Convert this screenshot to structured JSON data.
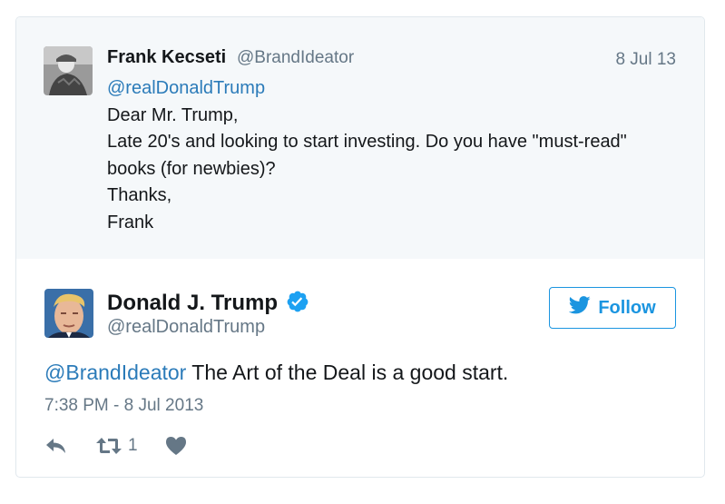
{
  "parent_tweet": {
    "name": "Frank Kecseti",
    "handle": "@BrandIdeator",
    "date": "8 Jul 13",
    "mention": "@realDonaldTrump",
    "lines": [
      "Dear Mr. Trump,",
      "Late 20's and looking to start investing. Do you have \"must-read\"",
      "books (for newbies)?",
      "Thanks,",
      "Frank"
    ]
  },
  "main_tweet": {
    "name": "Donald J. Trump",
    "handle": "@realDonaldTrump",
    "follow_label": "Follow",
    "mention": "@BrandIdeator",
    "text": " The Art of the Deal is a good start.",
    "timestamp": "7:38 PM - 8 Jul 2013",
    "retweet_count": "1"
  },
  "colors": {
    "link": "#2b7bb9",
    "follow_blue": "#1b95e0",
    "verified_blue": "#1da1f2",
    "muted": "#657786",
    "parent_bg": "#f5f8fa"
  },
  "icons": {
    "follow": "twitter-bird-icon",
    "verified": "verified-badge-icon",
    "reply": "reply-icon",
    "retweet": "retweet-icon",
    "like": "heart-icon"
  }
}
